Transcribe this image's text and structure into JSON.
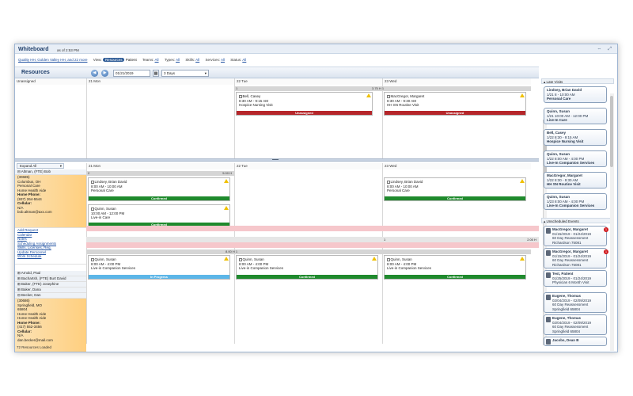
{
  "window": {
    "title": "Whiteboard",
    "as_of": "as of 2:53 PM",
    "icons": "⇔ ⤢"
  },
  "filters": {
    "quality_link": "Quality HH, Golden Valley HH, and 22 more",
    "view_label": "View:",
    "view_resources": "Resources",
    "view_patient": "Patient",
    "teams_label": "Teams:",
    "teams_value": "All",
    "types_label": "Types:",
    "types_value": "All",
    "skills_label": "Skills:",
    "skills_value": "All",
    "services_label": "Services:",
    "services_value": "All",
    "status_label": "Status:",
    "status_value": "All"
  },
  "toolbar": {
    "title": "Resources",
    "date": "01/21/2019",
    "range": "3 Days"
  },
  "top_section": {
    "unassigned_label": "Unassigned",
    "days": [
      "21 Mon",
      "22 Tue",
      "23 Wed"
    ],
    "bar_left": "1",
    "bar_right": "3.75 H 1",
    "visits": [
      {
        "name": "Bell, Casey",
        "time": "8:30 AM - 9:15 AM",
        "type": "Hospice Nursing Visit",
        "status": "Unassigned"
      },
      {
        "name": "MacGregor, Margaret",
        "time": "8:30 AM - 9:30 AM",
        "type": "HH SN Routine Visit",
        "status": "Unassigned"
      }
    ]
  },
  "bottom_section": {
    "expand_all": "Expand All",
    "days": [
      "21 Mon",
      "22 Tue",
      "23 Wed"
    ],
    "bar1_left": "2",
    "bar1_right": "5.00 H",
    "bar2_right": "8.00 H 1",
    "gray_row_left": "1",
    "gray_row_right": "2.00 H",
    "visits": [
      {
        "name": "Lindsey, Brian David",
        "time": "8:00 AM - 10:00 AM",
        "type": "Personal Care",
        "status": "Confirmed"
      },
      {
        "name": "Quinn, Susan",
        "time": "10:00 AM - 12:00 PM",
        "type": "Live-in Care",
        "status": "Confirmed"
      },
      {
        "name": "Lindsey, Brian David",
        "time": "8:00 AM - 10:00 AM",
        "type": "Personal Care",
        "status": "Confirmed"
      },
      {
        "name": "Quinn, Susan",
        "time": "8:00 AM - 4:00 PM",
        "type": "Live-in Companion Services",
        "status": "In Progress"
      },
      {
        "name": "Quinn, Susan",
        "time": "8:00 AM - 4:00 PM",
        "type": "Live-in Companion Services",
        "status": "Confirmed"
      },
      {
        "name": "Quinn, Susan",
        "time": "8:00 AM - 4:00 PM",
        "type": "Live-in Companion Services",
        "status": "Confirmed"
      }
    ]
  },
  "resources": {
    "r1_name": "Altman, (FTE) Bob",
    "r1_lines": [
      "(30685)",
      "Columbus, OH",
      "Personal Care",
      "Home Health Aide",
      "Home Phone:",
      "(937) 264-5544",
      "Cellular:",
      "N/A",
      "bob.altman@axx.com"
    ],
    "r1_links": [
      "Add Request",
      "Calendar",
      "Notes",
      "Scheduling Assignments",
      "Skills, Licenses, Req.",
      "Update Personnel",
      "Work Schedule"
    ],
    "r2_name": "Arnold, Paul",
    "r3_name": "Bachartsh, (FTE) Burt David",
    "r4_name": "Baker, (FTE) Josephine",
    "r5_name": "Baker, Dana",
    "r6_name": "Becker, Dan",
    "r6_lines": [
      "(30686)",
      "Springfield, MO",
      "65804",
      "Home Health Aide",
      "Home Health Aide",
      "Home Phone:",
      "(417) 552-3456",
      "Cellular:",
      "N/A",
      "dan.becker@mail.com"
    ],
    "footer": "72 Resources Loaded"
  },
  "late_visits": {
    "header": "Late Visits",
    "items": [
      {
        "name": "Lindsey, Brian David",
        "when": "1/21 8 - 10:00 AM",
        "what": "Personal Care"
      },
      {
        "name": "Quinn, Susan",
        "when": "1/21 10:00 AM - 12:00 PM",
        "what": "Live-In Care"
      },
      {
        "name": "Bell, Casey",
        "when": "1/22 8:30 - 9:15 AM",
        "what": "Hospice Nursing Visit"
      },
      {
        "name": "Quinn, Susan",
        "when": "1/22 8:00 AM - 4:00 PM",
        "what": "Live-In Companion Services"
      },
      {
        "name": "MacGregor, Margaret",
        "when": "1/22 8:30 - 9:30 AM",
        "what": "HH SN Routine Visit"
      },
      {
        "name": "Quinn, Susan",
        "when": "1/23 8:00 AM - 4:00 PM",
        "what": "Live-In Companion Services"
      }
    ]
  },
  "unscheduled": {
    "header": "Unscheduled Events",
    "items": [
      {
        "name": "MacGregor, Margaret",
        "dates": "01/15/2019 - 01/24/2019",
        "what": "60 Day Reassessment",
        "where": "Richardson 75081",
        "badge": "1"
      },
      {
        "name": "MacGregor, Margaret",
        "dates": "01/15/2019 - 01/24/2019",
        "what": "60 Day Reassessment",
        "where": "Richardson 75081",
        "badge": "1"
      },
      {
        "name": "Test, Patient",
        "dates": "01/25/2019 - 01/24/2019",
        "what": "Physician 6 Month Visit",
        "where": "",
        "badge": ""
      },
      {
        "name": "Eugene, Thomas",
        "dates": "02/04/2019 - 02/09/2019",
        "what": "60 Day Reassessment",
        "where": "Springfield 65804",
        "badge": ""
      },
      {
        "name": "Eugene, Thomas",
        "dates": "02/04/2019 - 02/09/2019",
        "what": "60 Day Reassessment",
        "where": "Springfield 65804",
        "badge": ""
      },
      {
        "name": "Jacobs, Dean B",
        "dates": "",
        "what": "",
        "where": "",
        "badge": ""
      }
    ]
  },
  "colors": {
    "confirmed": "#1f8a2d",
    "unassigned": "#b5262a",
    "in_progress": "#5cb6e8",
    "accent": "#2d5b96",
    "late_pink": "#f6c7cb",
    "resource_orange": "#ffcf7f"
  }
}
